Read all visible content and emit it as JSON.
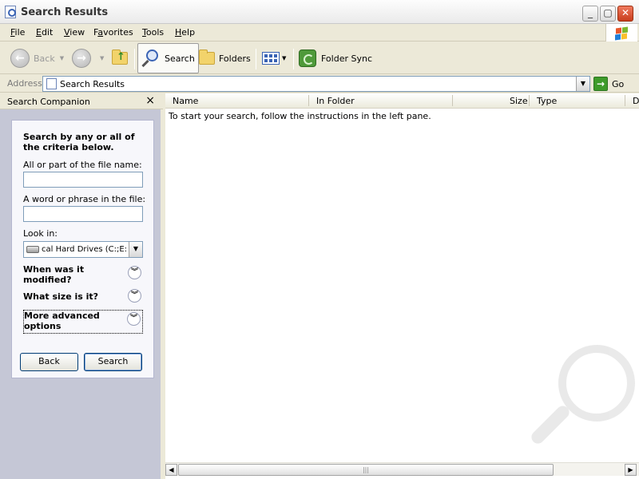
{
  "window": {
    "title": "Search Results"
  },
  "menu": {
    "items": [
      {
        "label": "File",
        "u": "F",
        "rest": "ile"
      },
      {
        "label": "Edit",
        "u": "E",
        "rest": "dit"
      },
      {
        "label": "View",
        "u": "V",
        "rest": "iew"
      },
      {
        "label": "Favorites",
        "u": "a",
        "pre": "F",
        "rest": "vorites"
      },
      {
        "label": "Tools",
        "u": "T",
        "rest": "ools"
      },
      {
        "label": "Help",
        "u": "H",
        "rest": "elp"
      }
    ]
  },
  "toolbar": {
    "back_label": "Back",
    "search_label": "Search",
    "folders_label": "Folders",
    "folder_sync_label": "Folder Sync"
  },
  "address": {
    "label": "Address",
    "value": "Search Results",
    "go_label": "Go"
  },
  "search_companion": {
    "header": "Search Companion",
    "close_glyph": "×",
    "heading": "Search by any or all of the criteria below.",
    "file_name_label": "All or part of the file name:",
    "file_name_value": "",
    "phrase_label": "A word or phrase in the file:",
    "phrase_value": "",
    "look_in_label": "Look in:",
    "look_in_value": "cal Hard Drives (C:;E:)",
    "when_modified": "When was it modified?",
    "what_size": "What size is it?",
    "more_options": "More advanced options",
    "back_button": "Back",
    "search_button": "Search"
  },
  "list": {
    "columns": [
      "Name",
      "In Folder",
      "Size",
      "Type",
      "D"
    ],
    "empty_message": "To start your search, follow the instructions in the left pane."
  },
  "colors": {
    "accent": "#003c74",
    "pane_bg": "#c5c7d6",
    "chrome_bg": "#ece9d8"
  }
}
